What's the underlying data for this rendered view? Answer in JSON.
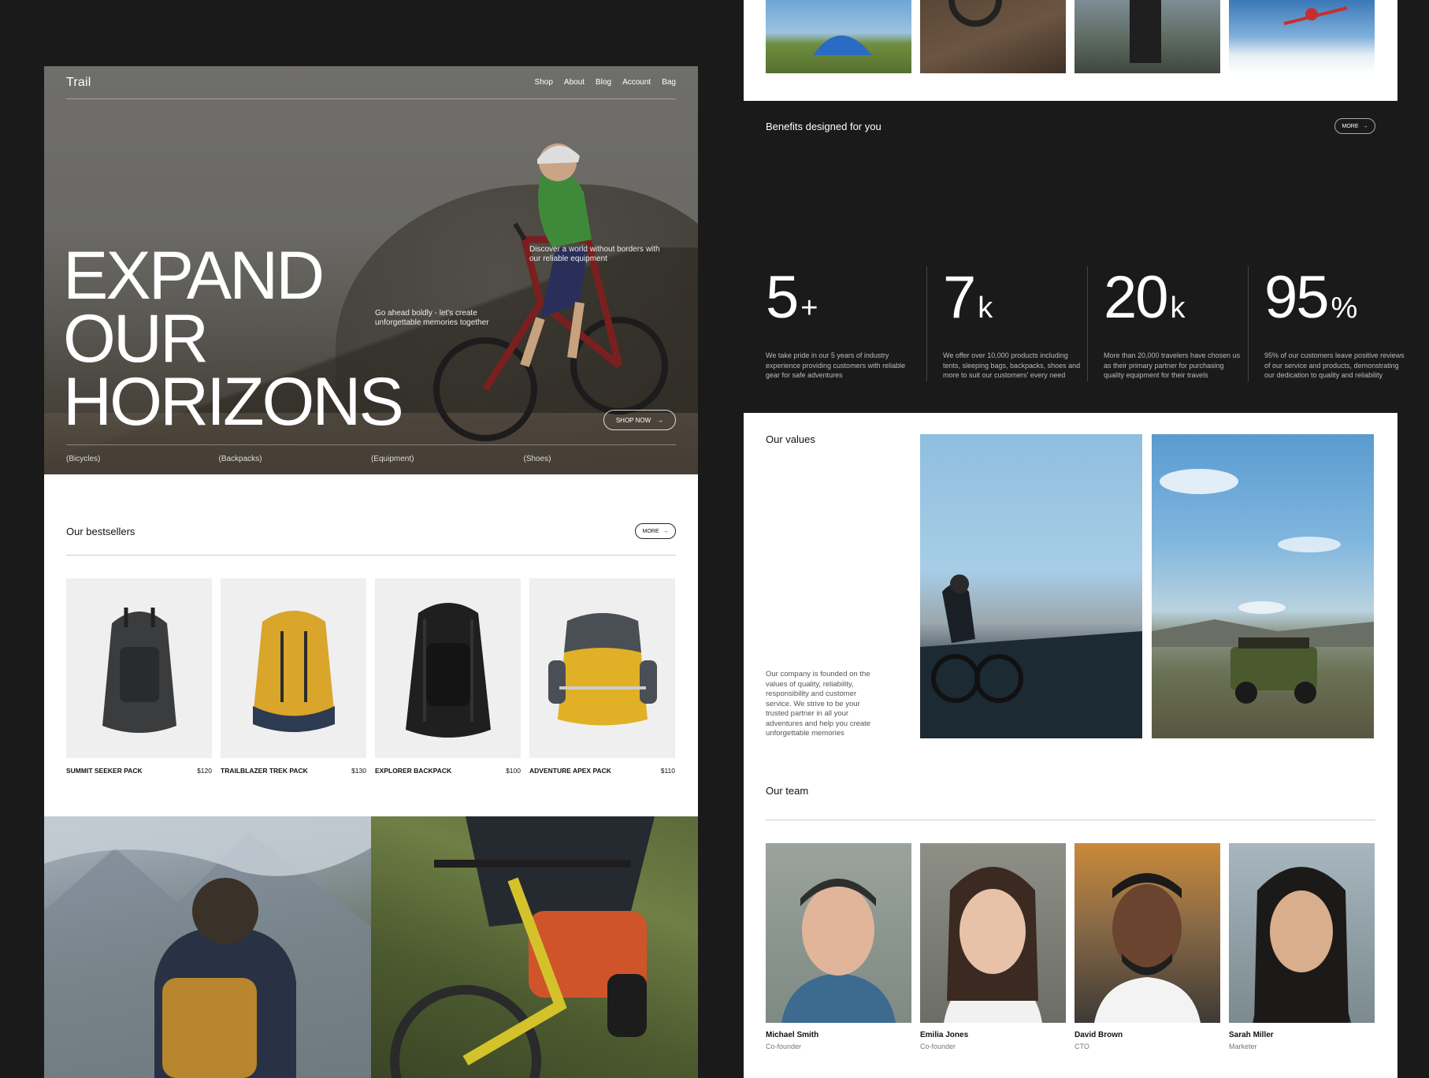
{
  "brand": "Trail",
  "nav": [
    "Shop",
    "About",
    "Blog",
    "Account",
    "Bag"
  ],
  "hero": {
    "title_lines": [
      "EXPAND",
      "OUR",
      "HORIZONS"
    ],
    "tagline_left": "Go ahead boldly - let's create unforgettable memories together",
    "tagline_right": "Discover a world without borders with our reliable equipment",
    "cta": "SHOP NOW",
    "categories": [
      "(Bicycles)",
      "(Backpacks)",
      "(Equipment)",
      "(Shoes)"
    ]
  },
  "bestsellers": {
    "title": "Our bestsellers",
    "more": "MORE",
    "products": [
      {
        "name": "SUMMIT SEEKER PACK",
        "price": "$120",
        "color": "#3b3c3e",
        "accent": "#2a2b2d"
      },
      {
        "name": "TRAILBLAZER TREK PACK",
        "price": "$130",
        "color": "#d9a52a",
        "accent": "#2c3a52"
      },
      {
        "name": "EXPLORER BACKPACK",
        "price": "$100",
        "color": "#1f1f20",
        "accent": "#141414"
      },
      {
        "name": "ADVENTURE APEX PACK",
        "price": "$110",
        "color": "#e0b126",
        "accent": "#4a4f56"
      }
    ]
  },
  "benefits": {
    "title": "Benefits designed for you",
    "more": "MORE",
    "stats": [
      {
        "value": "5",
        "suffix": "+",
        "desc": "We take pride in our 5 years of industry experience providing customers with reliable gear for safe adventures"
      },
      {
        "value": "7",
        "suffix": "k",
        "desc": "We offer over 10,000 products including tents, sleeping bags, backpacks, shoes and more to suit our customers' every need"
      },
      {
        "value": "20",
        "suffix": "k",
        "desc": "More than 20,000 travelers have chosen us as their primary partner for purchasing quality equipment for their travels"
      },
      {
        "value": "95",
        "suffix": "%",
        "desc": "95% of our customers leave positive reviews of our service and products, demonstrating our dedication to quality and reliability"
      }
    ]
  },
  "values": {
    "title": "Our values",
    "text": "Our company is founded on the values of quality, reliability, responsibility and customer service. We strive to be your trusted partner in all your adventures and help you create unforgettable memories"
  },
  "team": {
    "title": "Our team",
    "members": [
      {
        "name": "Michael Smith",
        "role": "Co-founder"
      },
      {
        "name": "Emilia Jones",
        "role": "Co-founder"
      },
      {
        "name": "David Brown",
        "role": "CTO"
      },
      {
        "name": "Sarah Miller",
        "role": "Marketer"
      }
    ]
  }
}
